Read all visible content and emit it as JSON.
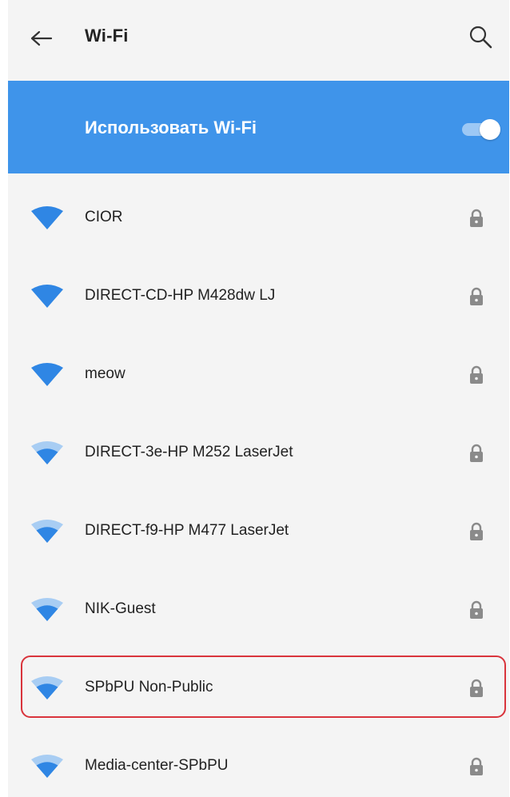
{
  "app_bar": {
    "title": "Wi-Fi",
    "back_icon": "arrow-left-icon",
    "search_icon": "search-icon"
  },
  "master_switch": {
    "label": "Использовать Wi-Fi",
    "state": "on",
    "color": "#3f94ea"
  },
  "networks": [
    {
      "name": "CIOR",
      "signal": "full",
      "secured": true
    },
    {
      "name": "DIRECT-CD-HP M428dw LJ",
      "signal": "full",
      "secured": true
    },
    {
      "name": "meow",
      "signal": "full",
      "secured": true
    },
    {
      "name": "DIRECT-3e-HP M252 LaserJet",
      "signal": "medium",
      "secured": true
    },
    {
      "name": "DIRECT-f9-HP M477 LaserJet",
      "signal": "medium",
      "secured": true
    },
    {
      "name": "NIK-Guest",
      "signal": "medium",
      "secured": true
    },
    {
      "name": "SPbPU Non-Public",
      "signal": "medium",
      "secured": true,
      "highlighted": true
    },
    {
      "name": "Media-center-SPbPU",
      "signal": "medium",
      "secured": true
    }
  ],
  "colors": {
    "accent": "#3f94ea",
    "wifi_signal": "#2f86e4",
    "wifi_weak": "#a8cdf3",
    "lock": "#8a8a8a",
    "highlight_border": "#d9343c"
  }
}
